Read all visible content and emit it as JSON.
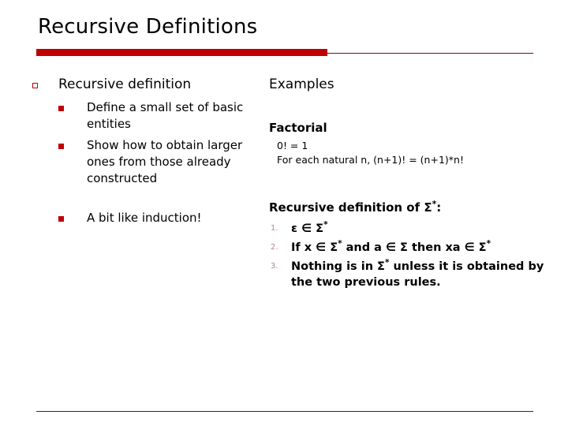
{
  "slide": {
    "title": "Recursive Definitions"
  },
  "theme": {
    "accent_red": "#c00000",
    "rule_dark_red": "#6e0f14",
    "number_marker_color": "#b08a8e",
    "text_color": "#000000",
    "background": "#ffffff"
  },
  "left_column": {
    "heading": "Recursive definition",
    "sub_bullets": [
      "Define a small set of basic entities",
      "Show how to obtain larger ones from those already constructed"
    ],
    "closing_bullet": "A bit like induction!"
  },
  "right_column": {
    "heading": "Examples",
    "factorial": {
      "heading": "Factorial",
      "lines": [
        "0! = 1",
        "For each natural n, (n+1)! = (n+1)*n!"
      ]
    },
    "sigma_star": {
      "heading_prefix": "Recursive definition of ",
      "heading_symbol": "Σ",
      "heading_superscript": "*",
      "heading_suffix": ":",
      "items": [
        {
          "number": "1.",
          "text": "ε ∈ Σ*",
          "parts": [
            "ε ∈ Σ",
            "*",
            ""
          ]
        },
        {
          "number": "2.",
          "text": "If x ∈ Σ* and a ∈ Σ then xa ∈ Σ*",
          "parts": [
            "If x ∈ Σ",
            "*",
            " and a ∈ Σ then xa  ∈ Σ",
            "*"
          ]
        },
        {
          "number": "3.",
          "text": "Nothing is in Σ* unless it is obtained by the two previous rules.",
          "parts": [
            "Nothing is in Σ",
            "*",
            " unless it is obtained by the two previous rules."
          ]
        }
      ]
    }
  }
}
